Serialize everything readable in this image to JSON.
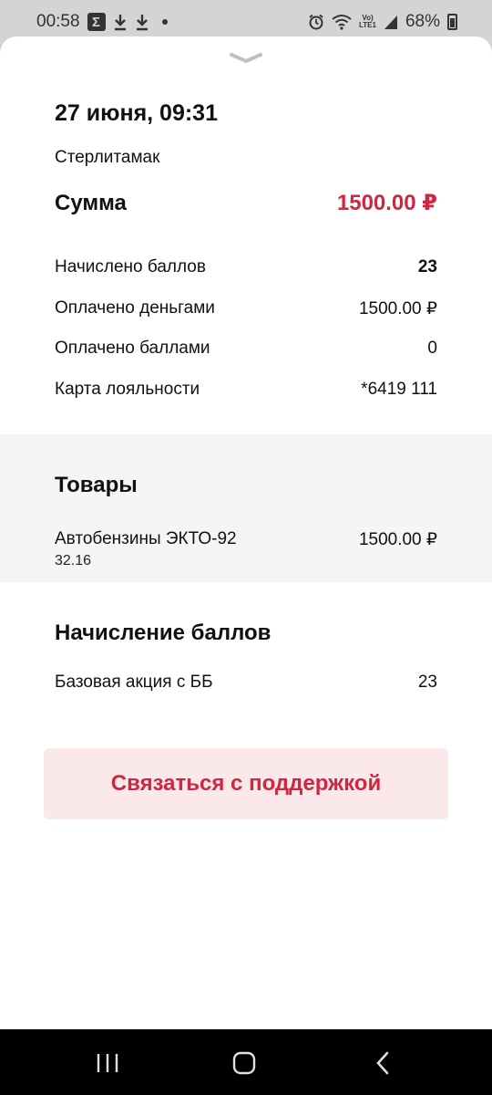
{
  "status_bar": {
    "time": "00:58",
    "battery": "68%",
    "network": "Vo))\nLTE1"
  },
  "header": {
    "date": "27 июня, 09:31",
    "city": "Стерлитамак"
  },
  "sum": {
    "label": "Сумма",
    "value": "1500.00 ₽"
  },
  "details": [
    {
      "label": "Начислено баллов",
      "value": "23"
    },
    {
      "label": "Оплачено деньгами",
      "value": "1500.00 ₽"
    },
    {
      "label": "Оплачено баллами",
      "value": "0"
    },
    {
      "label": "Карта лояльности",
      "value": "*6419 111"
    }
  ],
  "goods": {
    "title": "Товары",
    "items": [
      {
        "name": "Автобензины ЭКТО-92",
        "price": "1500.00 ₽",
        "quantity": "32.16"
      }
    ]
  },
  "points": {
    "title": "Начисление баллов",
    "items": [
      {
        "label": "Базовая акция с ББ",
        "value": "23"
      }
    ]
  },
  "support_button": {
    "label": "Связаться с поддержкой"
  },
  "colors": {
    "accent": "#d0263f",
    "button_bg": "#fbe8ea",
    "section_bg": "#f5f5f5"
  }
}
